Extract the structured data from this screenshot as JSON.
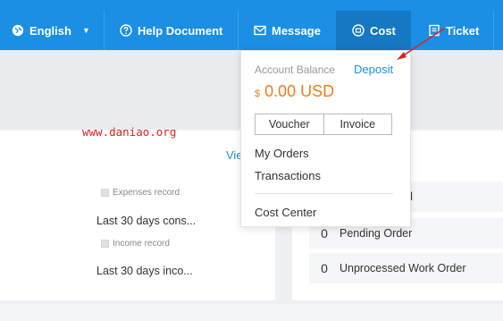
{
  "nav": {
    "language": "English",
    "help": "Help Document",
    "message": "Message",
    "cost": "Cost",
    "ticket": "Ticket"
  },
  "dropdown": {
    "balance_label": "Account Balance",
    "deposit": "Deposit",
    "currency_symbol": "$",
    "amount": "0.00 USD",
    "voucher": "Voucher",
    "invoice": "Invoice",
    "my_orders": "My Orders",
    "transactions": "Transactions",
    "cost_center": "Cost Center"
  },
  "watermark": "www.daniao.org",
  "left_panel": {
    "view_link": "Vie",
    "expenses_record": "Expenses record",
    "expenses_stat": "Last 30 days cons...",
    "income_record": "Income record",
    "income_stat": "Last 30 days inco..."
  },
  "right_panel": {
    "rows": [
      {
        "count": "",
        "label": "ed"
      },
      {
        "count": "0",
        "label": "Pending Order"
      },
      {
        "count": "0",
        "label": "Unprocessed Work Order"
      }
    ]
  },
  "colors": {
    "nav_bg": "#1a8fe3",
    "nav_active": "#1578c2",
    "amount": "#f07d17",
    "link": "#1a8fe3",
    "annotation": "#e0201c"
  }
}
